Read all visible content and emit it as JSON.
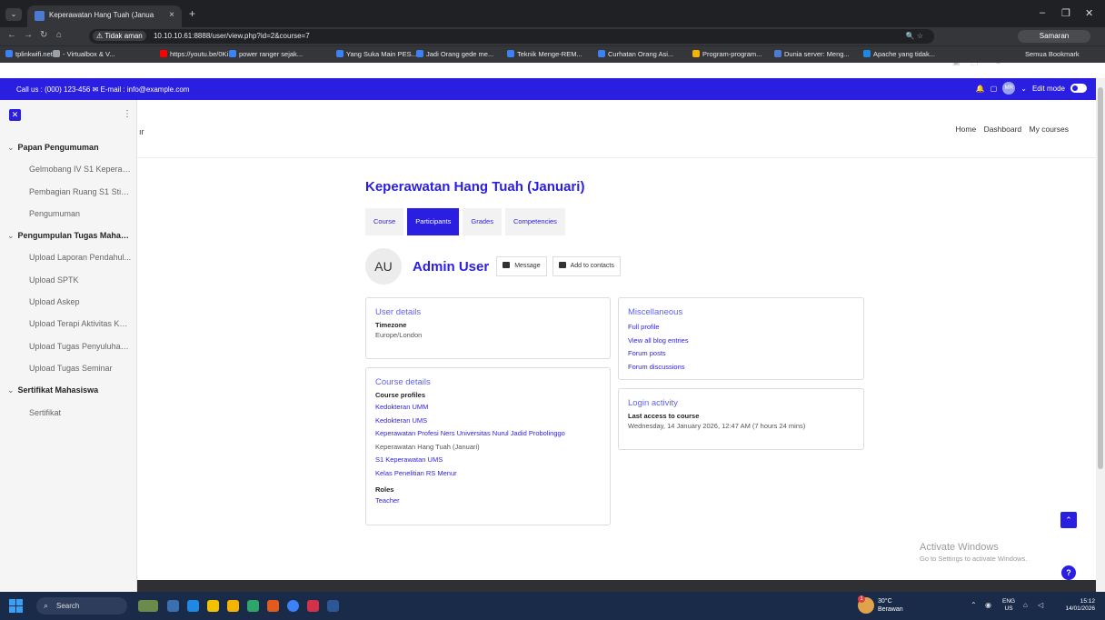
{
  "browser": {
    "tab_title": "Keperawatan Hang Tuah (Janua",
    "security_label": "Tidak aman",
    "url": "10.10.10.61:8888/user/view.php?id=2&course=7",
    "profile_label": "Samaran",
    "bookmarks": [
      {
        "label": "tplinkwifi.net",
        "color": "#3b82f6"
      },
      {
        "label": "- Virtualbox & V...",
        "color": "#9aa0a6"
      },
      {
        "label": "https://youtu.be/0Ki...",
        "color": "#ff0000"
      },
      {
        "label": "power ranger sejak...",
        "color": "#3b82f6"
      },
      {
        "label": "Yang Suka Main PES...",
        "color": "#3b82f6"
      },
      {
        "label": "Jadi Orang gede me...",
        "color": "#3b82f6"
      },
      {
        "label": "Teknik Menge-REM...",
        "color": "#3b82f6"
      },
      {
        "label": "Curhatan Orang Asi...",
        "color": "#3b82f6"
      },
      {
        "label": "Program-program...",
        "color": "#f5b400"
      },
      {
        "label": "Dunia server: Meng...",
        "color": "#4c7bd6"
      },
      {
        "label": "Apache yang tidak...",
        "color": "#1e88e5"
      }
    ],
    "all_bookmarks": "Semua Bookmark"
  },
  "topbar": {
    "contact": "Call us : (000) 123-456  ✉ E-mail : info@example.com",
    "avatar": "MR",
    "edit_mode": "Edit mode"
  },
  "drawer": {
    "items": [
      {
        "type": "section",
        "label": "Papan Pengumuman"
      },
      {
        "type": "item",
        "label": "Gelmobang IV S1 Keperaw..."
      },
      {
        "type": "item",
        "label": "Pembagian Ruang S1 Stike..."
      },
      {
        "type": "item",
        "label": "Pengumuman"
      },
      {
        "type": "section",
        "label": "Pengumpulan Tugas Mahas..."
      },
      {
        "type": "item",
        "label": "Upload Laporan Pendahul..."
      },
      {
        "type": "item",
        "label": "Upload SPTK"
      },
      {
        "type": "item",
        "label": "Upload Askep"
      },
      {
        "type": "item",
        "label": "Upload Terapi Aktivitas Kel..."
      },
      {
        "type": "item",
        "label": "Upload Tugas Penyuluhan ..."
      },
      {
        "type": "item",
        "label": "Upload Tugas Seminar"
      },
      {
        "type": "section",
        "label": "Sertifikat Mahasiswa"
      },
      {
        "type": "item",
        "label": "Sertifikat"
      }
    ]
  },
  "header": {
    "brand_fragment": "ır",
    "nav": [
      "Home",
      "Dashboard",
      "My courses"
    ]
  },
  "main": {
    "title": "Keperawatan Hang Tuah (Januari)",
    "tabs": [
      "Course",
      "Participants",
      "Grades",
      "Competencies"
    ],
    "active_tab": "Participants",
    "user": {
      "initials": "AU",
      "name": "Admin User",
      "message_btn": "Message",
      "contacts_btn": "Add to contacts"
    },
    "user_details": {
      "heading": "User details",
      "timezone_label": "Timezone",
      "timezone_value": "Europe/London"
    },
    "course_details": {
      "heading": "Course details",
      "profiles_label": "Course profiles",
      "courses": [
        {
          "label": "Kedokteran UMM",
          "link": true
        },
        {
          "label": "Kedokteran UMS",
          "link": true
        },
        {
          "label": "Keperawatan Profesi Ners Universitas Nurul Jadid Probolinggo",
          "link": true
        },
        {
          "label": "Keperawatan Hang Tuah (Januari)",
          "link": false
        },
        {
          "label": "S1 Keperawatan UMS",
          "link": true
        },
        {
          "label": "Kelas Penelitian RS Menur",
          "link": true
        }
      ],
      "roles_label": "Roles",
      "role": "Teacher"
    },
    "misc": {
      "heading": "Miscellaneous",
      "links": [
        "Full profile",
        "View all blog entries",
        "Forum posts",
        "Forum discussions"
      ]
    },
    "login": {
      "heading": "Login activity",
      "label": "Last access to course",
      "value": "Wednesday, 14 January 2026, 12:47 AM  (7 hours 24 mins)"
    }
  },
  "activate": {
    "line1": "Activate Windows",
    "line2": "Go to Settings to activate Windows."
  },
  "taskbar": {
    "search": "Search",
    "weather_temp": "30°C",
    "weather_desc": "Berawan",
    "weather_badge": "1",
    "lang1": "ENG",
    "lang2": "US",
    "time": "15:12",
    "date": "14/01/2026"
  }
}
